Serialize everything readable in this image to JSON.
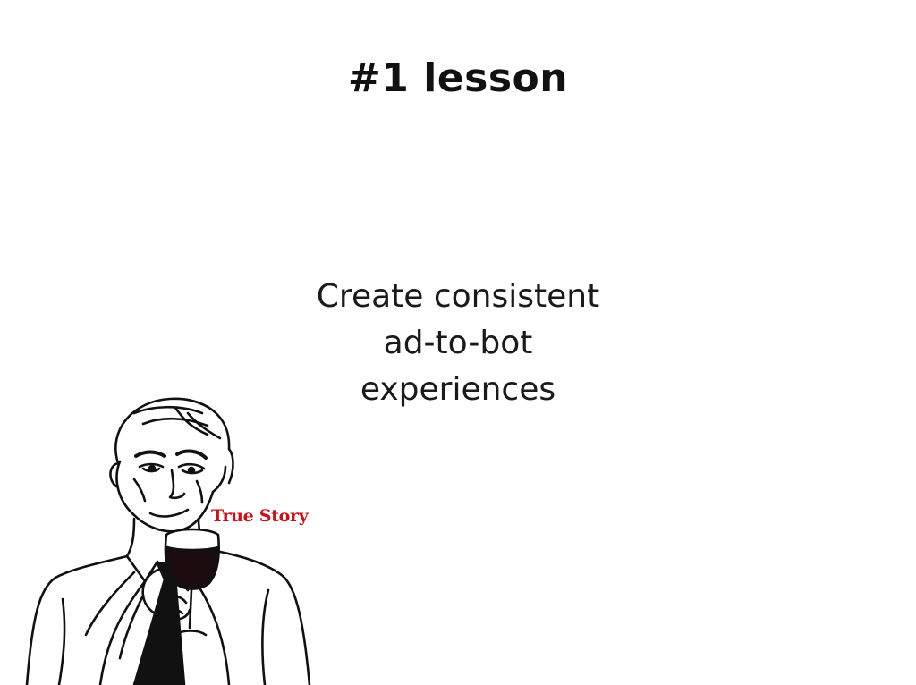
{
  "slide": {
    "title": "#1 lesson",
    "body_lines": [
      "Create consistent",
      "ad-to-bot",
      "experiences"
    ]
  },
  "meme": {
    "caption": "True Story",
    "caption_color": "#c0161d",
    "icon": "true-story-meme-illustration"
  }
}
